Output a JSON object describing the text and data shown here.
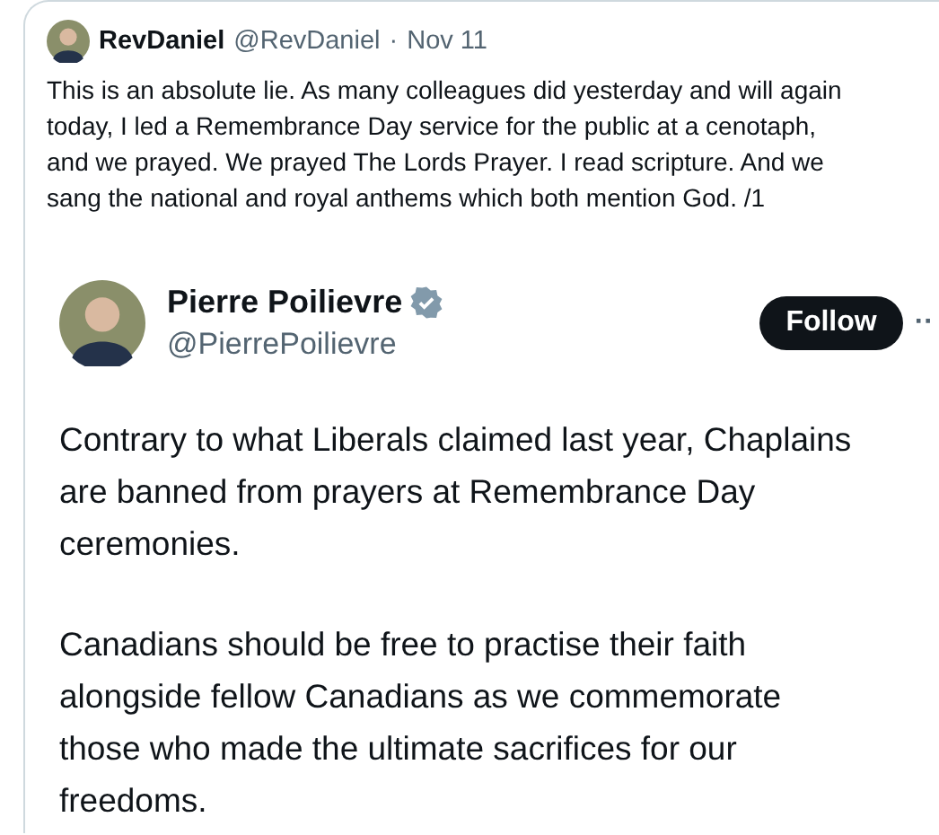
{
  "reply": {
    "name": "RevDaniel",
    "handle": "@RevDaniel",
    "separator": "·",
    "date": "Nov 11",
    "lines": [
      "This is an absolute lie. As many colleagues did yesterday and will again",
      "today, I led a Remembrance Day service for the public at a cenotaph,",
      "and we prayed. We prayed The Lords Prayer. I read scripture. And we",
      "sang the national and royal anthems which both mention God. /1"
    ]
  },
  "quoted": {
    "name": "Pierre Poilievre",
    "verified": true,
    "handle": "@PierrePoilievre",
    "follow_button": "Follow",
    "more": "··",
    "paragraphs": [
      [
        "Contrary to what Liberals claimed last year, Chaplains",
        "are banned from prayers at Remembrance Day",
        "ceremonies."
      ],
      [
        "Canadians should be free to practise their faith",
        "alongside fellow Canadians as we commemorate",
        "those who made the ultimate sacrifices for our",
        "freedoms."
      ]
    ]
  }
}
